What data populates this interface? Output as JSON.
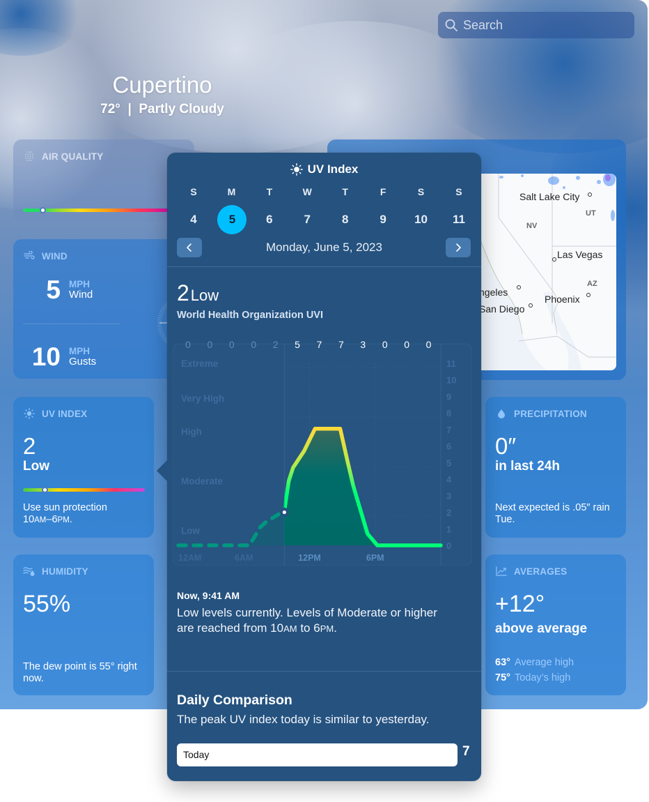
{
  "search": {
    "placeholder": "Search"
  },
  "location": {
    "city": "Cupertino",
    "summary": "72°  |  Partly Cloudy"
  },
  "cards": {
    "air_quality": {
      "title": "AIR QUALITY",
      "icon": "air-quality-dots-icon",
      "indicator_fraction": 0.12
    },
    "map": {
      "labels": [
        "Salt Lake City",
        "UT",
        "NV",
        "Las Vegas",
        "AZ",
        "ngeles",
        "Phoenix",
        "San Diego"
      ]
    },
    "wind": {
      "title": "WIND",
      "icon": "wind-icon",
      "wind_value": "5",
      "wind_unit": "MPH",
      "wind_label": "Wind",
      "gust_value": "10",
      "gust_unit": "MPH",
      "gust_label": "Gusts"
    },
    "uv_index": {
      "title": "UV INDEX",
      "icon": "sun-icon",
      "value": "2",
      "category": "Low",
      "indicator_fraction": 0.18,
      "desc_line1": "Use sun protection",
      "desc_line2_a": "10",
      "desc_line2_b": "AM",
      "desc_line2_c": "–6",
      "desc_line2_d": "PM",
      "desc_line2_e": "."
    },
    "humidity": {
      "title": "HUMIDITY",
      "icon": "humidity-icon",
      "value": "55%",
      "desc": "The dew point is 55° right now."
    },
    "precipitation": {
      "title": "PRECIPITATION",
      "icon": "raindrop-icon",
      "value": "0″",
      "sub": "in last 24h",
      "desc": "Next expected is .05″ rain Tue."
    },
    "averages": {
      "title": "AVERAGES",
      "icon": "chart-trend-icon",
      "value": "+12°",
      "sub": "above average",
      "rows": [
        {
          "value": "63°",
          "label": "Average high"
        },
        {
          "value": "75°",
          "label": "Today’s high"
        }
      ]
    }
  },
  "popover": {
    "title": "UV Index",
    "week": {
      "days": [
        "S",
        "M",
        "T",
        "W",
        "T",
        "F",
        "S",
        "S"
      ],
      "dates": [
        "4",
        "5",
        "6",
        "7",
        "8",
        "9",
        "10",
        "11"
      ],
      "selected_index": 1
    },
    "date_label": "Monday, June 5, 2023",
    "current": {
      "value": "2",
      "category": "Low"
    },
    "scale_name": "World Health Organization UVI",
    "now_label": "Now, 9:41 AM",
    "now_desc_a": "Low levels currently. Levels of Moderate or higher are reached from 10",
    "now_desc_am": "AM",
    "now_desc_b": " to 6",
    "now_desc_pm": "PM",
    "now_desc_c": ".",
    "comparison": {
      "title": "Daily Comparison",
      "desc": "The peak UV index today is similar to yesterday.",
      "bar_label": "Today",
      "bar_value": "7"
    }
  },
  "chart_data": {
    "type": "area",
    "title": "UV Index",
    "xlabel": "",
    "ylabel": "UV Index",
    "ylim": [
      0,
      11
    ],
    "xlim_hours": [
      0,
      24
    ],
    "x_tick_labels": [
      {
        "hour": 0,
        "label": "12AM"
      },
      {
        "hour": 6,
        "label": "6AM"
      },
      {
        "hour": 12,
        "label": "12PM"
      },
      {
        "hour": 18,
        "label": "6PM"
      }
    ],
    "y_ticks": [
      0,
      1,
      2,
      3,
      4,
      5,
      6,
      7,
      8,
      9,
      10,
      11
    ],
    "category_bands": [
      {
        "label": "Low",
        "y": 0.9
      },
      {
        "label": "Moderate",
        "y": 3.9
      },
      {
        "label": "High",
        "y": 6.9
      },
      {
        "label": "Very High",
        "y": 8.9
      },
      {
        "label": "Extreme",
        "y": 11
      }
    ],
    "hourly_labels": {
      "hours": [
        0,
        2,
        4,
        6,
        8,
        10,
        12,
        14,
        16,
        18,
        20,
        22
      ],
      "values": [
        "0",
        "0",
        "0",
        "0",
        "2",
        "5",
        "7",
        "7",
        "3",
        "0",
        "0",
        "0"
      ],
      "past_count": 5
    },
    "series": [
      {
        "name": "UV Index",
        "x": [
          0,
          6.5,
          7.5,
          8,
          9.7,
          9.9,
          10.1,
          10.5,
          11.5,
          12.5,
          13.0,
          14.8,
          15.5,
          16.0,
          17.3,
          18.2,
          19,
          24
        ],
        "y": [
          0,
          0,
          1.1,
          1.4,
          2.1,
          3,
          3.9,
          4.7,
          5.7,
          7.05,
          7.05,
          7.05,
          5.0,
          3.6,
          0.7,
          0,
          0,
          0
        ]
      }
    ],
    "current_time_hour": 9.7,
    "current_value": 2
  }
}
